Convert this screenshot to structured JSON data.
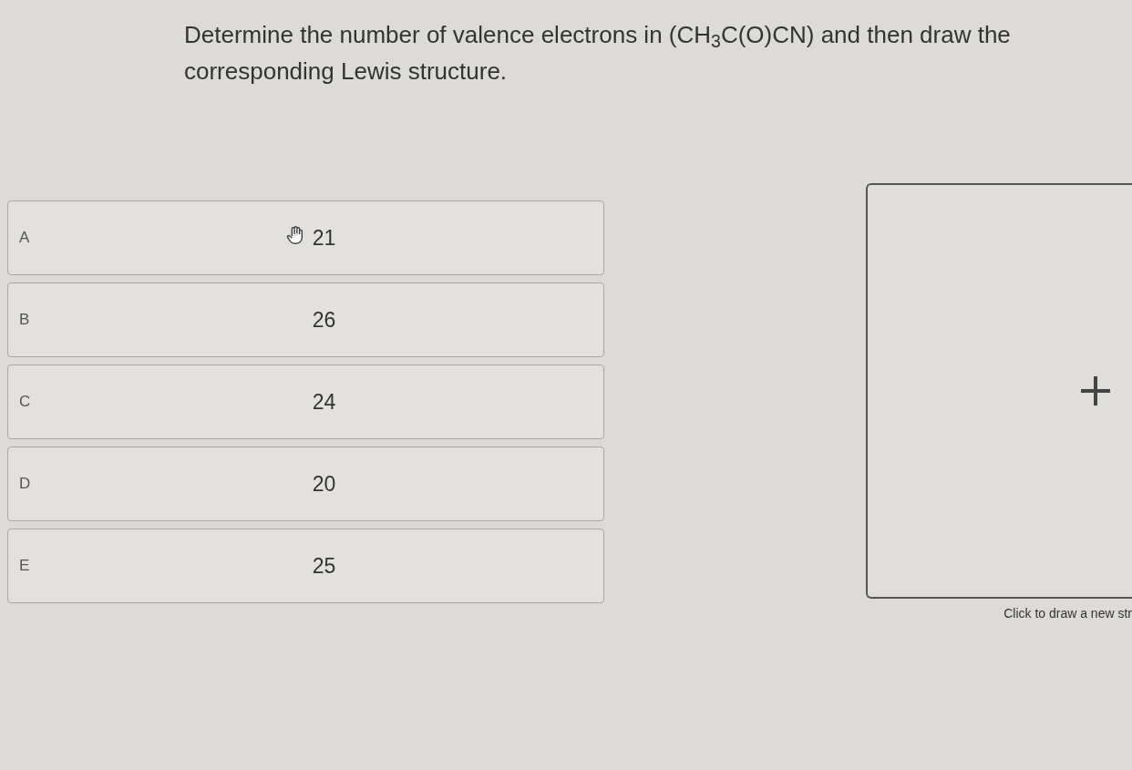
{
  "question": "Determine the number of valence electrons in (CH$_{3}$C(O)CN) and then draw the corresponding Lewis structure.",
  "options": [
    {
      "letter": "A",
      "value": "21",
      "hovered": true,
      "selected": false
    },
    {
      "letter": "B",
      "value": "26",
      "hovered": false,
      "selected": false
    },
    {
      "letter": "C",
      "value": "24",
      "hovered": false,
      "selected": false
    },
    {
      "letter": "D",
      "value": "20",
      "hovered": false,
      "selected": false
    },
    {
      "letter": "E",
      "value": "25",
      "hovered": false,
      "selected": false
    }
  ],
  "drawing_area": {
    "caption": "Click to draw a new str"
  }
}
